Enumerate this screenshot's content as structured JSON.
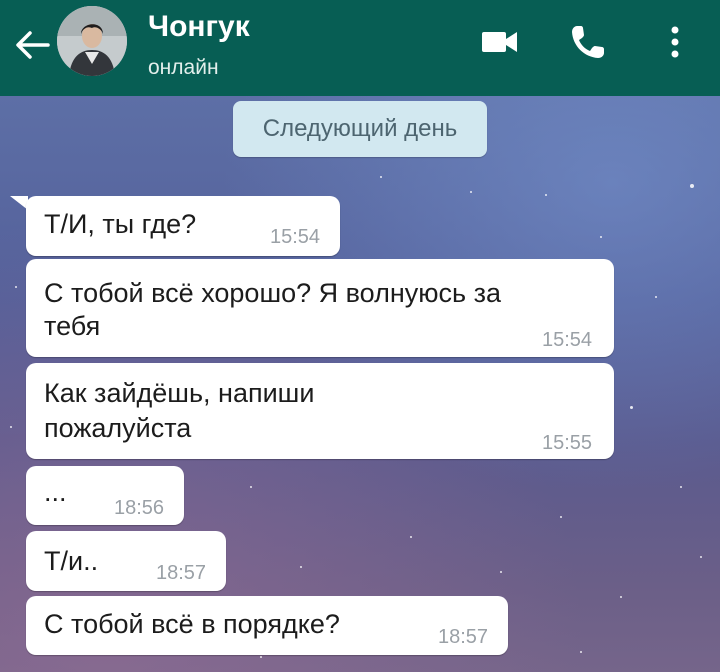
{
  "header": {
    "contact_name": "Чонгук",
    "status": "онлайн",
    "icons": [
      "back-arrow-icon",
      "video-call-icon",
      "phone-icon",
      "more-options-icon"
    ],
    "background_color": "#075e54"
  },
  "date_chip": {
    "label": "Следующий день"
  },
  "messages": [
    {
      "text_lines": [
        "Т/И, ты где?"
      ],
      "time": "15:54"
    },
    {
      "text_lines": [
        "С тобой всё хорошо? Я волнуюсь за",
        "тебя"
      ],
      "time": "15:54"
    },
    {
      "text_lines": [
        "Как зайдёшь, напиши",
        "пожалуйста"
      ],
      "time": "15:55"
    },
    {
      "text_lines": [
        "..."
      ],
      "time": "18:56"
    },
    {
      "text_lines": [
        "Т/и.."
      ],
      "time": "18:57"
    },
    {
      "text_lines": [
        "С тобой всё в порядке?"
      ],
      "time": "18:57"
    }
  ]
}
